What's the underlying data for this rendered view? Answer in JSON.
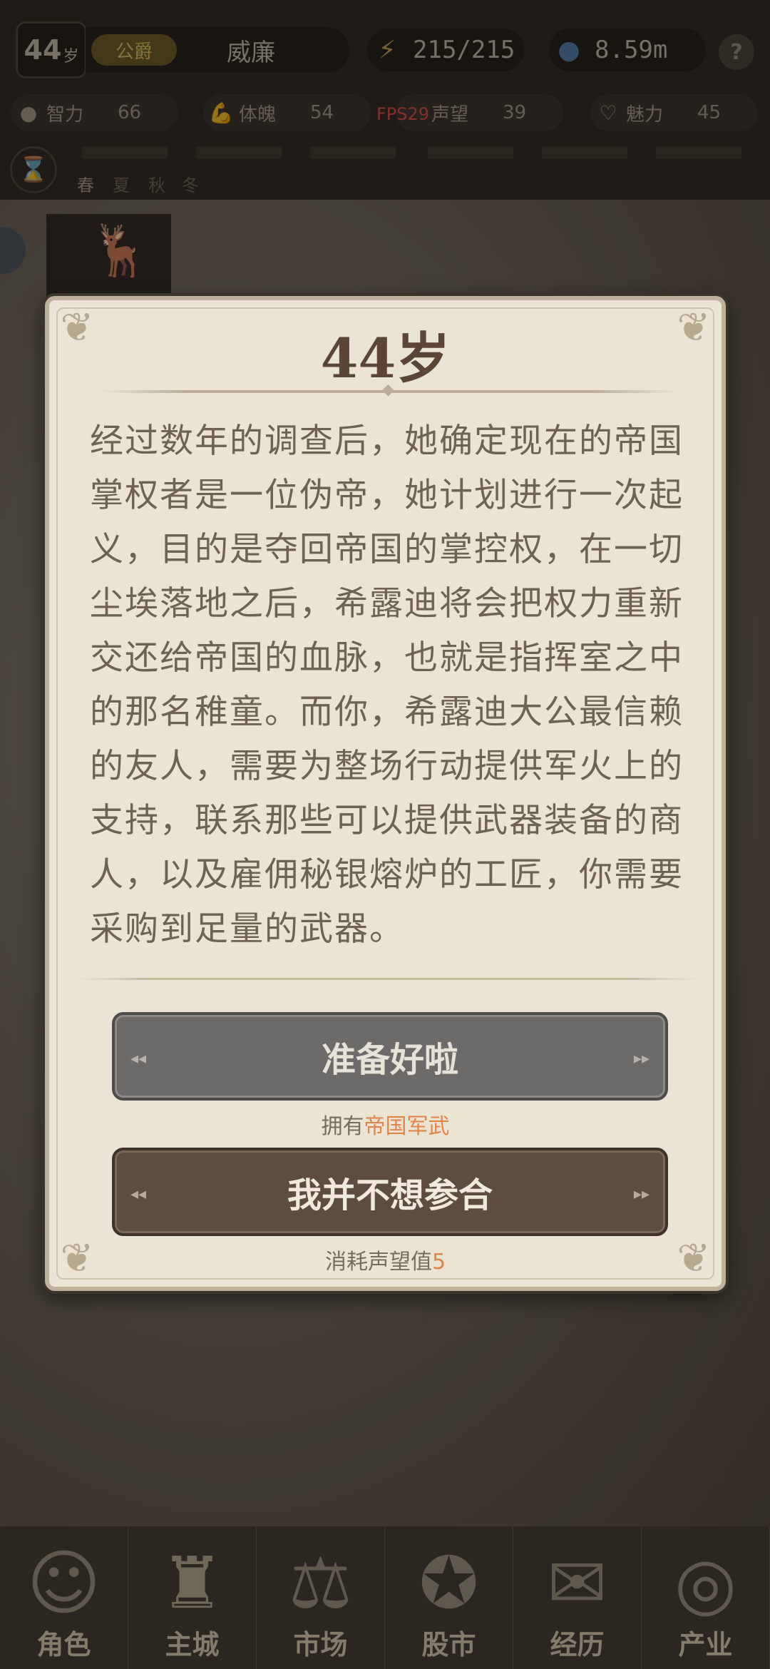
{
  "hud": {
    "age_number": "44",
    "age_unit": "岁",
    "title": "公爵",
    "player_name": "威廉",
    "energy": "215/215",
    "money": "8.59m",
    "help": "?",
    "fps": "FPS29",
    "attributes": [
      {
        "label": "智力",
        "value": "66",
        "icon": "brain-icon"
      },
      {
        "label": "体魄",
        "value": "54",
        "icon": "muscle-icon"
      },
      {
        "label": "声望",
        "value": "39",
        "icon": "fame-icon"
      },
      {
        "label": "魅力",
        "value": "45",
        "icon": "heartbeat-icon"
      }
    ],
    "seasons": [
      "春",
      "夏",
      "秋",
      "冬"
    ]
  },
  "modal": {
    "title": "44岁",
    "story": "经过数年的调查后，她确定现在的帝国掌权者是一位伪帝，她计划进行一次起义，目的是夺回帝国的掌控权，在一切尘埃落地之后，希露迪将会把权力重新交还给帝国的血脉，也就是指挥室之中的那名稚童。而你，希露迪大公最信赖的友人，需要为整场行动提供军火上的支持，联系那些可以提供武器装备的商人，以及雇佣秘银熔炉的工匠，你需要采购到足量的武器。",
    "option_ready": "准备好啦",
    "option_ready_req_prefix": "拥有",
    "option_ready_req_item": "帝国军武",
    "option_decline": "我并不想参合",
    "option_decline_req_prefix": "消耗声望值",
    "option_decline_req_value": "5"
  },
  "nav": [
    {
      "label": "角色",
      "icon": "character-icon"
    },
    {
      "label": "主城",
      "icon": "castle-icon"
    },
    {
      "label": "市场",
      "icon": "scales-icon"
    },
    {
      "label": "股市",
      "icon": "stock-icon"
    },
    {
      "label": "经历",
      "icon": "scroll-icon"
    },
    {
      "label": "产业",
      "icon": "coins-icon"
    }
  ]
}
